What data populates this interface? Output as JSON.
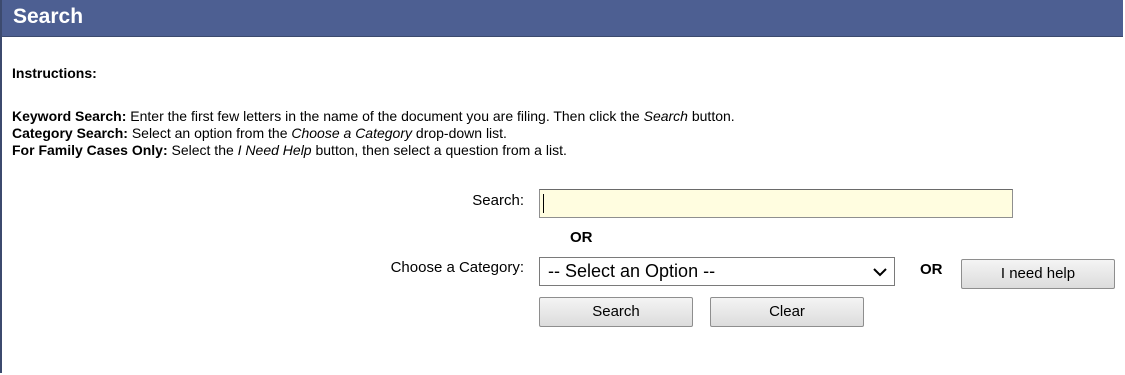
{
  "panel": {
    "title": "Search"
  },
  "instructions": {
    "heading": "Instructions:",
    "keyword": {
      "label": "Keyword Search:",
      "text_before": " Enter the first few letters in the name of the document you are filing. Then click the ",
      "emphasis": "Search",
      "text_after": " button."
    },
    "category": {
      "label": "Category Search:",
      "text_before": " Select an option from the ",
      "emphasis": "Choose a Category",
      "text_after": " drop-down list."
    },
    "family": {
      "label": "For Family Cases Only:",
      "text_before": " Select the ",
      "emphasis": "I Need Help",
      "text_after": " button, then select a question from a list."
    }
  },
  "form": {
    "search_label": "Search:",
    "search_value": "",
    "or_middle": "OR",
    "category_label": "Choose a Category:",
    "category_selected": "-- Select an Option --",
    "or_right": "OR",
    "help_button": "I need help",
    "search_button": "Search",
    "clear_button": "Clear"
  },
  "colors": {
    "header_bg": "#4d5f92",
    "input_bg": "#fffde0"
  },
  "icons": {
    "dropdown": "chevron-down-icon"
  }
}
